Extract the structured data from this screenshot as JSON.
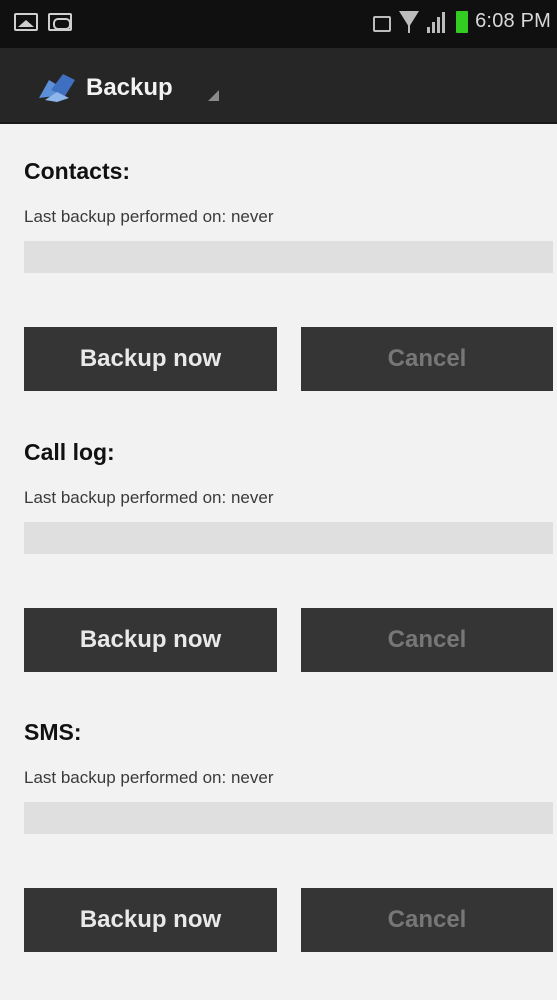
{
  "status_bar": {
    "time": "6:08 PM",
    "left_icons": [
      "gallery-icon",
      "voicemail-icon"
    ],
    "right_icons": [
      "nfc-icon",
      "wifi-icon",
      "signal-icon",
      "battery-icon"
    ],
    "battery_color": "#33cc22"
  },
  "action_bar": {
    "title": "Backup",
    "logo_icon": "app-logo-icon",
    "background": "#262626"
  },
  "sections": [
    {
      "title": "Contacts:",
      "status": "Last backup performed on: never",
      "progress": 0,
      "backup_label": "Backup now",
      "cancel_label": "Cancel"
    },
    {
      "title": "Call log:",
      "status": "Last backup performed on: never",
      "progress": 0,
      "backup_label": "Backup now",
      "cancel_label": "Cancel"
    },
    {
      "title": "SMS:",
      "status": "Last backup performed on: never",
      "progress": 0,
      "backup_label": "Backup now",
      "cancel_label": "Cancel"
    }
  ]
}
